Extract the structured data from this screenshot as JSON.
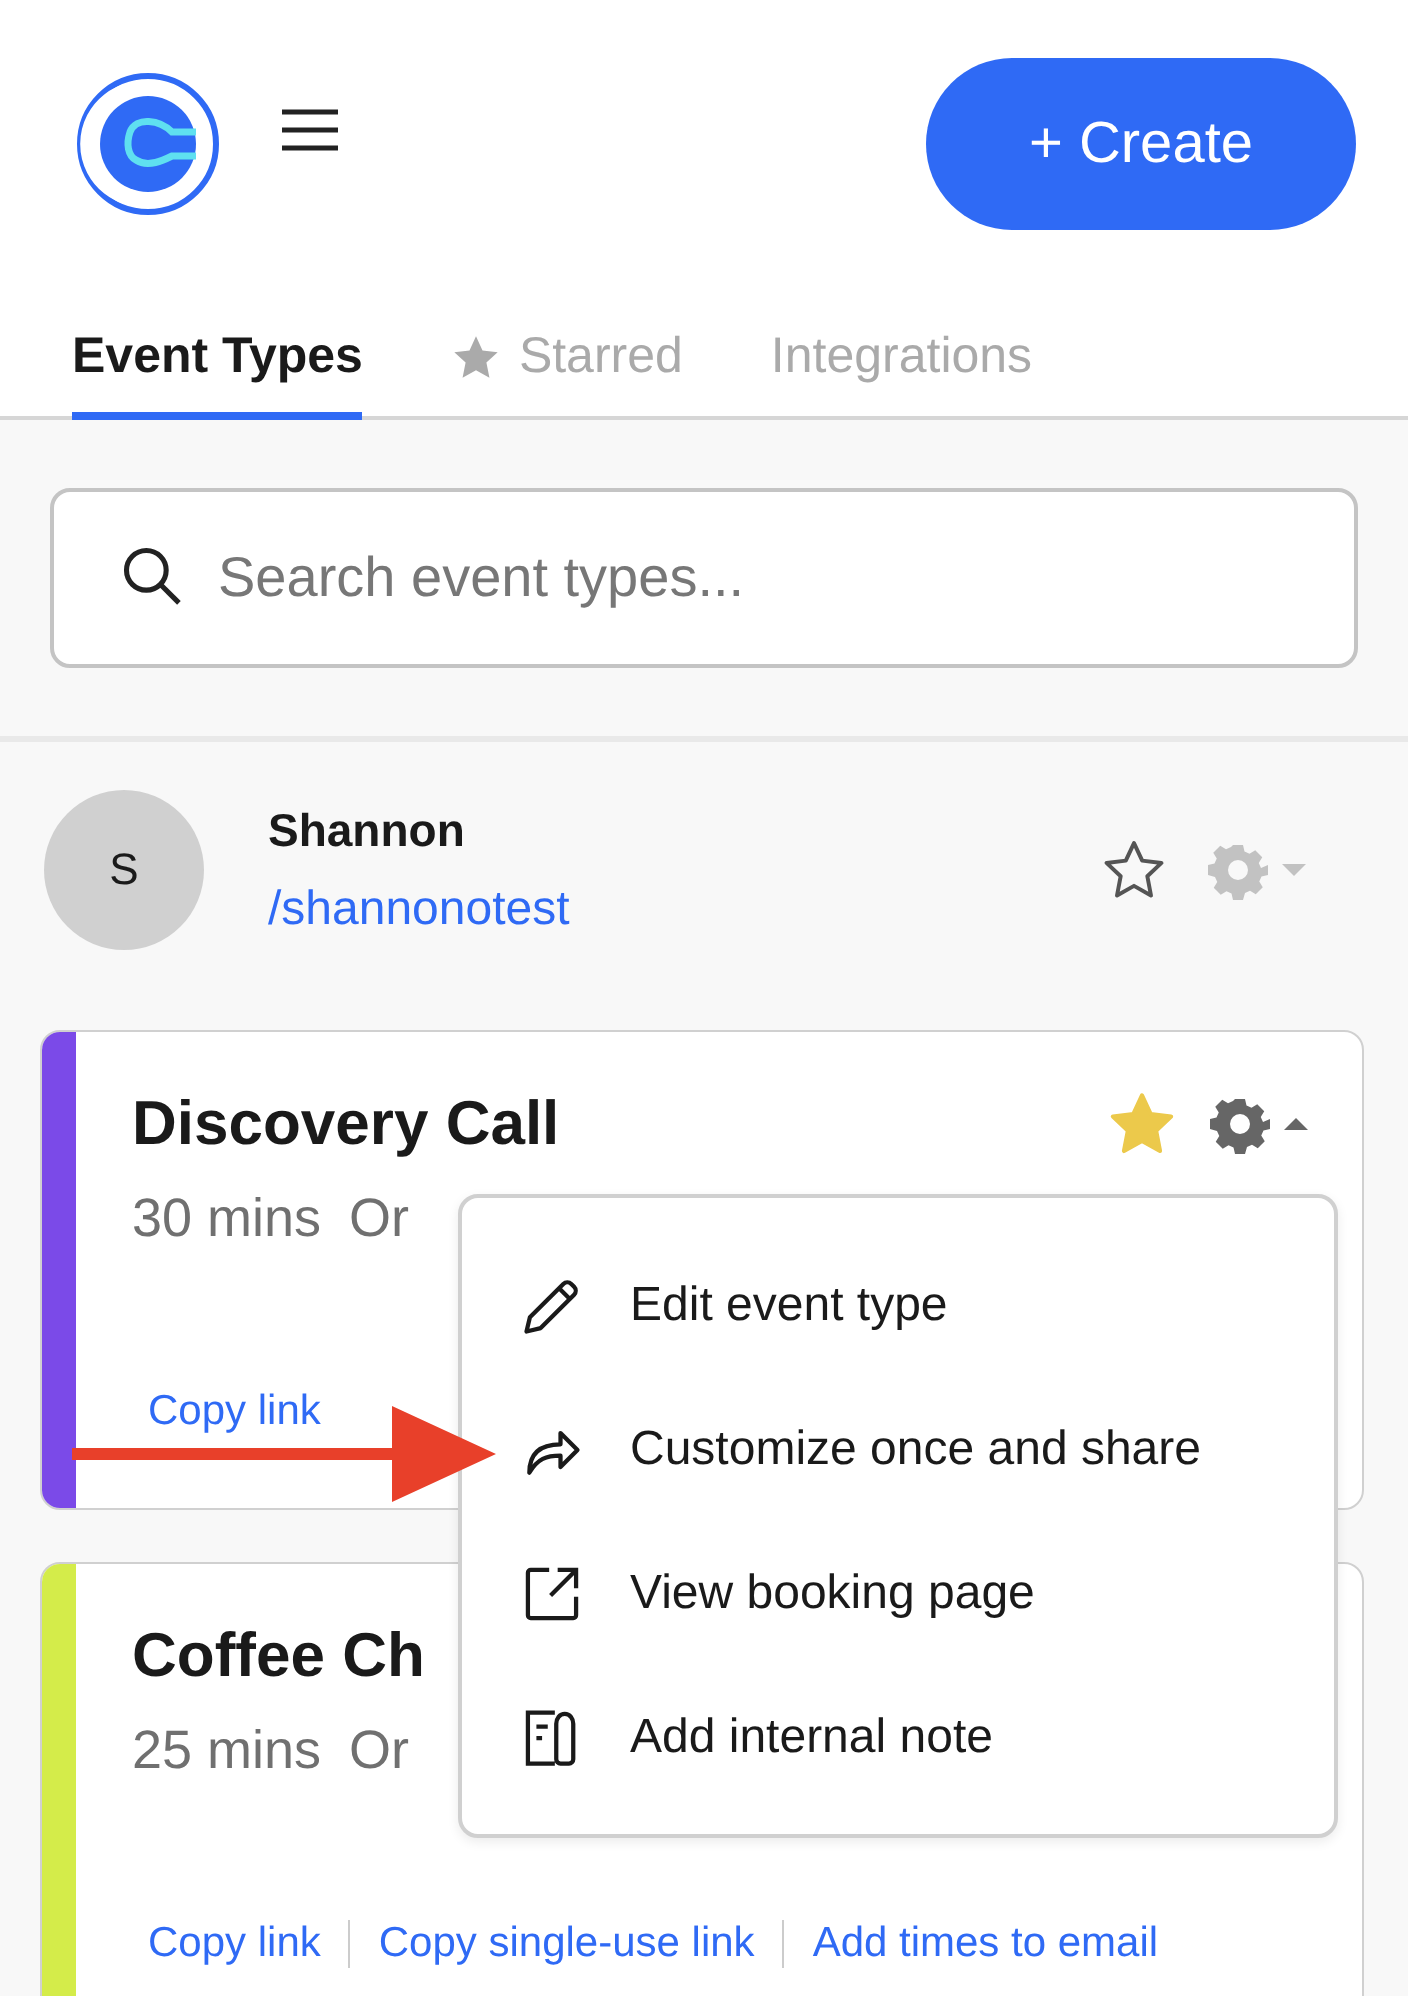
{
  "header": {
    "create_button": "+ Create"
  },
  "tabs": [
    {
      "label": "Event Types",
      "kind": "plain",
      "selected": true
    },
    {
      "label": "Starred",
      "kind": "starred",
      "selected": false
    },
    {
      "label": "Integrations",
      "kind": "plain",
      "selected": false
    }
  ],
  "search": {
    "placeholder": "Search event types..."
  },
  "user": {
    "avatar_letter": "S",
    "name": "Shannon",
    "link": "/shannonotest",
    "starred": false
  },
  "event_types": [
    {
      "title": "Discovery Call",
      "duration": "30 mins",
      "location": "Or",
      "color": "#7b4ae8",
      "starred": true,
      "menu_open": true,
      "links": [
        "Copy link"
      ]
    },
    {
      "title": "Coffee Ch",
      "duration": "25 mins",
      "location": "Or",
      "color": "#d4ec4a",
      "links": [
        "Copy link",
        "Copy single-use link",
        "Add times to email"
      ]
    }
  ],
  "context_menu": {
    "items": [
      {
        "label": "Edit event type",
        "kind": "edit"
      },
      {
        "label": "Customize once and share",
        "kind": "share"
      },
      {
        "label": "View booking page",
        "kind": "external"
      },
      {
        "label": "Add internal note",
        "kind": "note"
      }
    ]
  }
}
